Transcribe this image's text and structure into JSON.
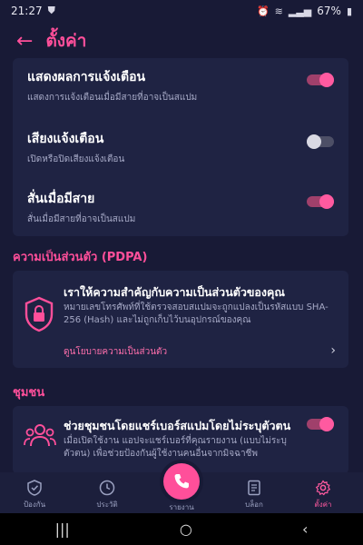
{
  "status_bar": {
    "time": "21:27",
    "battery": "67%"
  },
  "header": {
    "title": "ตั้งค่า"
  },
  "settings": [
    {
      "title": "แสดงผลการแจ้งเตือน",
      "desc": "แสดงการแจ้งเตือนเมื่อมีสายที่อาจเป็นสแปม",
      "enabled": true
    },
    {
      "title": "เสียงแจ้งเตือน",
      "desc": "เปิดหรือปิดเสียงแจ้งเตือน",
      "enabled": false
    },
    {
      "title": "สั่นเมื่อมีสาย",
      "desc": "สั่นเมื่อมีสายที่อาจเป็นสแปม",
      "enabled": true
    }
  ],
  "privacy": {
    "section_label": "ความเป็นส่วนตัว (PDPA)",
    "title": "เราให้ความสำคัญกับความเป็นส่วนตัวของคุณ",
    "desc": "หมายเลขโทรศัพท์ที่ใช้ตรวจสอบสแปมจะถูกแปลงเป็นรหัสแบบ SHA-256 (Hash) และไม่ถูกเก็บไว้บนอุปกรณ์ของคุณ",
    "link": "ดูนโยบายความเป็นส่วนตัว"
  },
  "community": {
    "section_label": "ชุมชน",
    "title": "ช่วยชุมชนโดยแชร์เบอร์สแปมโดยไม่ระบุตัวตน",
    "desc": "เมื่อเปิดใช้งาน แอปจะแชร์เบอร์ที่คุณรายงาน (แบบไม่ระบุตัวตน) เพื่อช่วยป้องกันผู้ใช้งานคนอื่นจากมิจฉาชีพ",
    "enabled": true
  },
  "bottom_nav": [
    {
      "label": "ป้องกัน",
      "icon": "shield-check-icon"
    },
    {
      "label": "ประวัติ",
      "icon": "clock-icon"
    },
    {
      "label": "รายงาน",
      "icon": "phone-icon"
    },
    {
      "label": "บล็อก",
      "icon": "list-icon"
    },
    {
      "label": "ตั้งค่า",
      "icon": "gear-icon"
    }
  ],
  "colors": {
    "accent": "#ff4f9a",
    "background": "#181a36",
    "card": "#1f2343"
  }
}
